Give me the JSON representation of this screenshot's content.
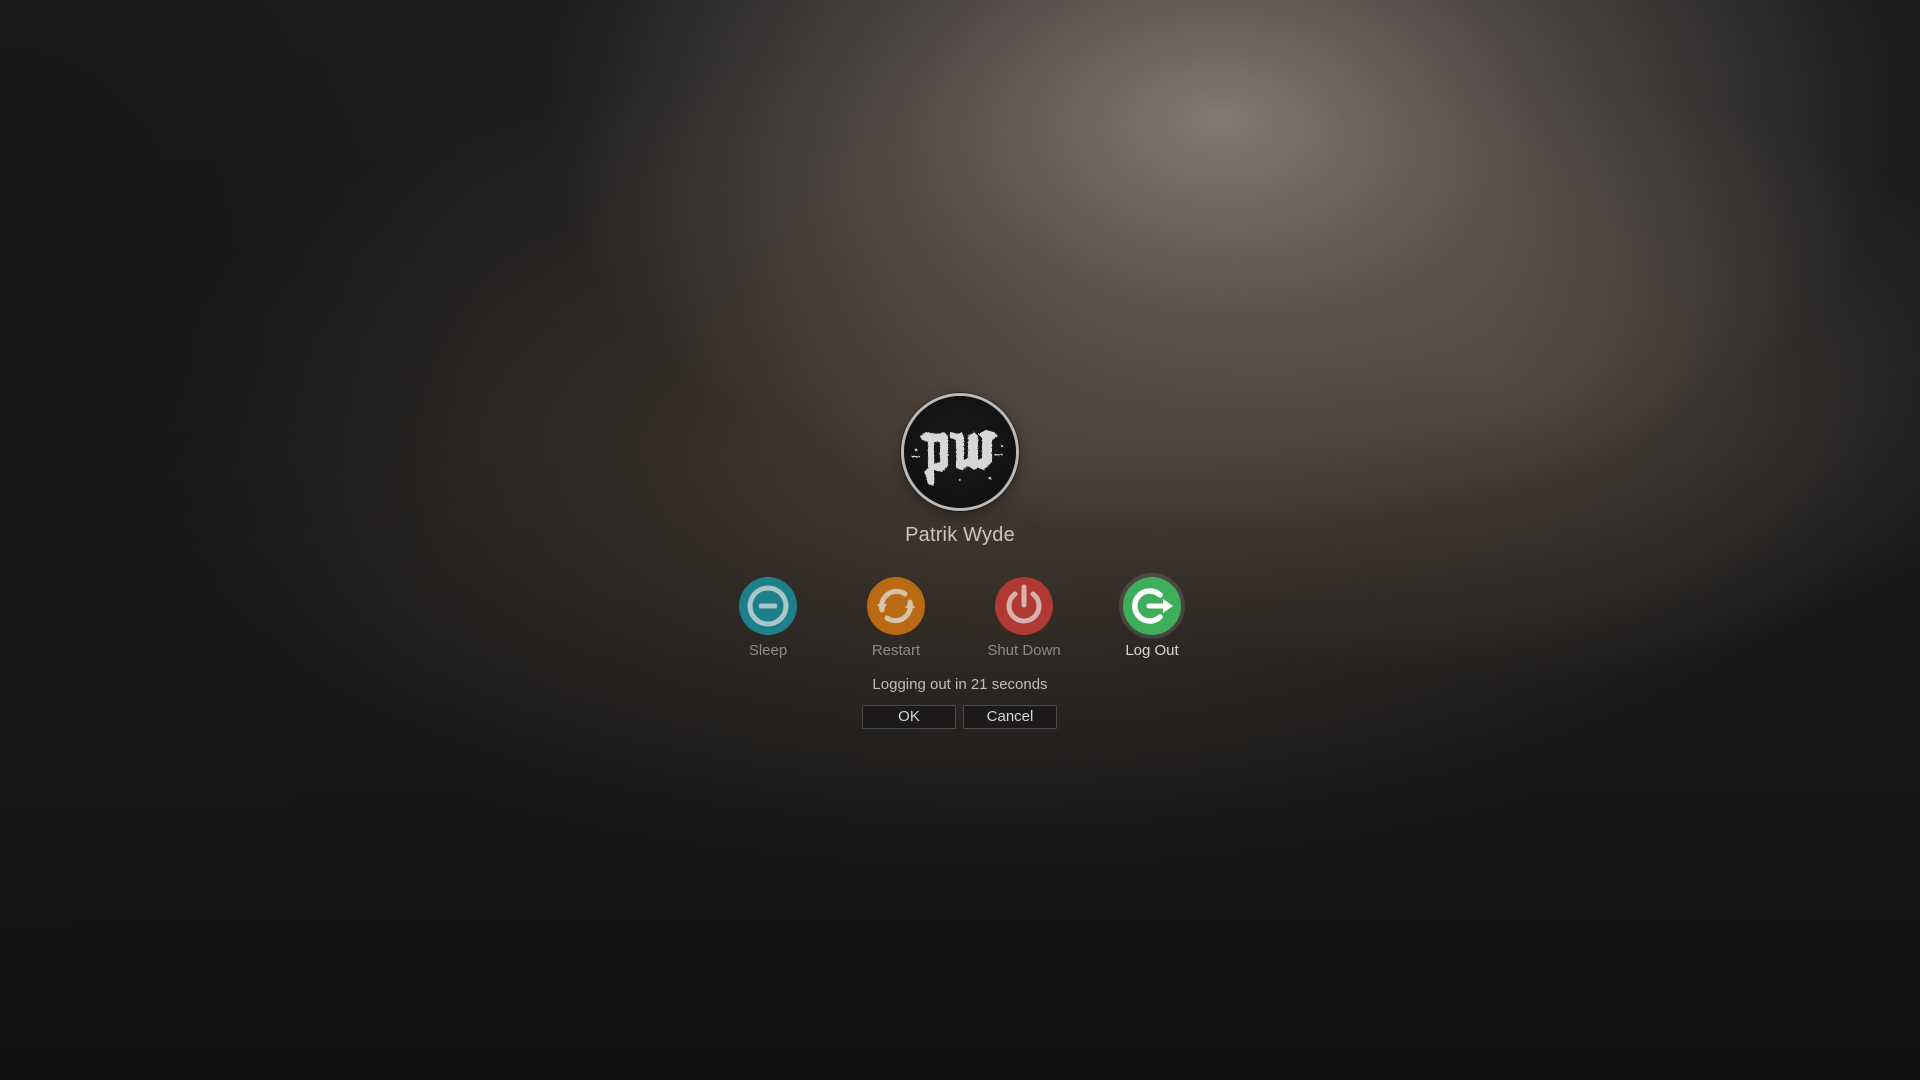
{
  "user": {
    "name": "Patrik Wyde",
    "avatar_text": "pw"
  },
  "actions": [
    {
      "id": "sleep",
      "label": "Sleep",
      "icon": "minus-circle-icon",
      "color": "#1d7f8a",
      "selected": false
    },
    {
      "id": "restart",
      "label": "Restart",
      "icon": "refresh-arrows-icon",
      "color": "#b96a12",
      "selected": false
    },
    {
      "id": "shutdown",
      "label": "Shut Down",
      "icon": "power-icon",
      "color": "#b03a33",
      "selected": false
    },
    {
      "id": "logout",
      "label": "Log Out",
      "icon": "logout-arrow-icon",
      "color": "#3fae5a",
      "selected": true
    }
  ],
  "status": {
    "text": "Logging out in 21 seconds"
  },
  "dialog": {
    "ok_label": "OK",
    "cancel_label": "Cancel"
  }
}
